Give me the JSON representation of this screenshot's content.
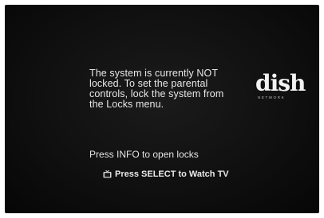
{
  "message": {
    "line1": "The system is currently NOT",
    "line2": "locked. To set the parental",
    "line3": "controls, lock the system from",
    "line4": "the Locks menu."
  },
  "logo": {
    "word": "dish",
    "subtitle": "NETWORK",
    "icon": "dish-network-logo"
  },
  "info_text": "Press INFO to open locks",
  "select_text": "Press SELECT to Watch TV",
  "select_icon": "tv-icon",
  "colors": {
    "background": "#101010",
    "text": "#e8e8e8"
  }
}
